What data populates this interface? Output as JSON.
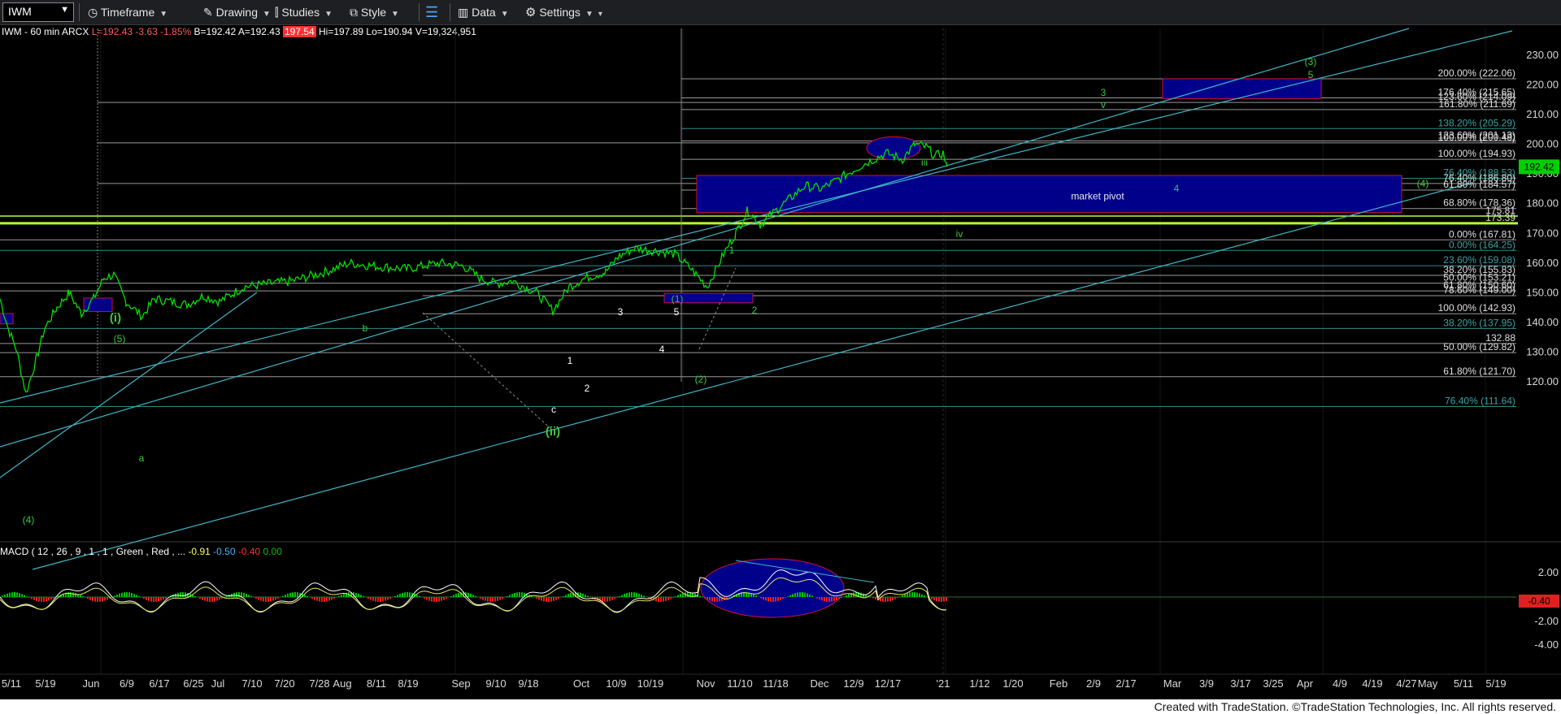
{
  "toolbar": {
    "symbol": "IWM",
    "timeframe": "Timeframe",
    "drawing": "Drawing",
    "studies": "Studies",
    "style": "Style",
    "data": "Data",
    "settings": "Settings"
  },
  "header": {
    "symbol_info": "IWM - 60 min  ARCX",
    "last": "L=192.43",
    "change": "-3.63",
    "change_pct": "-1.85%",
    "bid": "B=192.42",
    "ask": "A=192.43",
    "open": "197.54",
    "high": "Hi=197.89",
    "low": "Lo=190.94",
    "volume": "V=19,324,951"
  },
  "price_axis": {
    "ticks": [
      "230.00",
      "220.00",
      "210.00",
      "200.00",
      "190.00",
      "180.00",
      "170.00",
      "160.00",
      "150.00",
      "140.00",
      "130.00",
      "120.00"
    ],
    "current_price": "192.42"
  },
  "macd": {
    "label": "MACD ( 12 , 26 , 9 , 1 , 1 , Green , Red , ...",
    "values": [
      "-0.91",
      "-0.50",
      "-0.40",
      "0.00"
    ],
    "axis_ticks": [
      "2.00",
      "-2.00",
      "-4.00"
    ],
    "current": "-0.40"
  },
  "time_axis": {
    "labels": [
      "5/11",
      "5/19",
      "Jun",
      "6/9",
      "6/17",
      "6/25",
      "Jul",
      "7/10",
      "7/20",
      "7/28",
      "Aug",
      "8/11",
      "8/19",
      "Sep",
      "9/10",
      "9/18",
      "Oct",
      "10/9",
      "10/19",
      "Nov",
      "11/10",
      "11/18",
      "Dec",
      "12/9",
      "12/17",
      "'21",
      "1/12",
      "1/20",
      "Feb",
      "2/9",
      "2/17",
      "Mar",
      "3/9",
      "3/17",
      "3/25",
      "Apr",
      "4/9",
      "4/19",
      "4/27",
      "May",
      "5/11",
      "5/19"
    ]
  },
  "fib_labels": [
    {
      "text": "200.00% (222.06)",
      "price": 222.06
    },
    {
      "text": "176.40% (215.65)",
      "price": 215.65
    },
    {
      "text": "123.60% (214.09)",
      "price": 214.09
    },
    {
      "text": "161.80% (211.69)",
      "price": 211.69
    },
    {
      "text": "138.20% (205.29)",
      "price": 205.29
    },
    {
      "text": "123.60% (201.13)",
      "price": 201.13
    },
    {
      "text": "100.00% (200.48)",
      "price": 200.48
    },
    {
      "text": "100.00% (194.93)",
      "price": 194.93
    },
    {
      "text": "76.40% (188.53)",
      "price": 188.53
    },
    {
      "text": "76.40% (186.80)",
      "price": 186.8
    },
    {
      "text": "61.80% (184.57)",
      "price": 184.57
    },
    {
      "text": "68.80% (178.36)",
      "price": 178.36
    },
    {
      "text": "175.81",
      "price": 175.81
    },
    {
      "text": "173.39",
      "price": 173.39
    },
    {
      "text": "0.00% (167.81)",
      "price": 167.81
    },
    {
      "text": "0.00% (164.25)",
      "price": 164.25
    },
    {
      "text": "23.60% (159.08)",
      "price": 159.08
    },
    {
      "text": "38.20% (155.83)",
      "price": 155.83
    },
    {
      "text": "50.00% (153.21)",
      "price": 153.21
    },
    {
      "text": "61.80% (150.60)",
      "price": 150.6
    },
    {
      "text": "78.60% (149.00)",
      "price": 149.0
    },
    {
      "text": "100.00% (142.93)",
      "price": 142.93
    },
    {
      "text": "38.20% (137.95)",
      "price": 137.95
    },
    {
      "text": "132.88",
      "price": 132.88
    },
    {
      "text": "50.00% (129.82)",
      "price": 129.82
    },
    {
      "text": "61.80% (121.70)",
      "price": 121.7
    },
    {
      "text": "76.40% (111.64)",
      "price": 111.64
    }
  ],
  "wave_labels": [
    "(3)",
    "5",
    "3",
    "v",
    "iii",
    "4",
    "(4)",
    "iv",
    "1",
    "2",
    "(1)",
    "5",
    "3",
    "4",
    "1",
    "2",
    "(2)",
    "b",
    "c",
    "(ii)",
    "(i)",
    "(5)",
    "a",
    "(4)"
  ],
  "annotations": {
    "market_pivot": "market pivot"
  },
  "colors": {
    "price": "#00e000",
    "channel": "#3fb6c8",
    "fib_line": "#b4b4b4",
    "box_fill": "#00008b",
    "box_border": "#d0103a",
    "wave_label": "#3cc83c",
    "fib_label": "#e0e0e0",
    "teal_label": "#3aa3a3",
    "pivot_line": "#b6ff3a",
    "current_price": "#00d000"
  },
  "footer": {
    "credit": "Created with TradeStation. ©TradeStation Technologies, Inc. All rights reserved."
  }
}
